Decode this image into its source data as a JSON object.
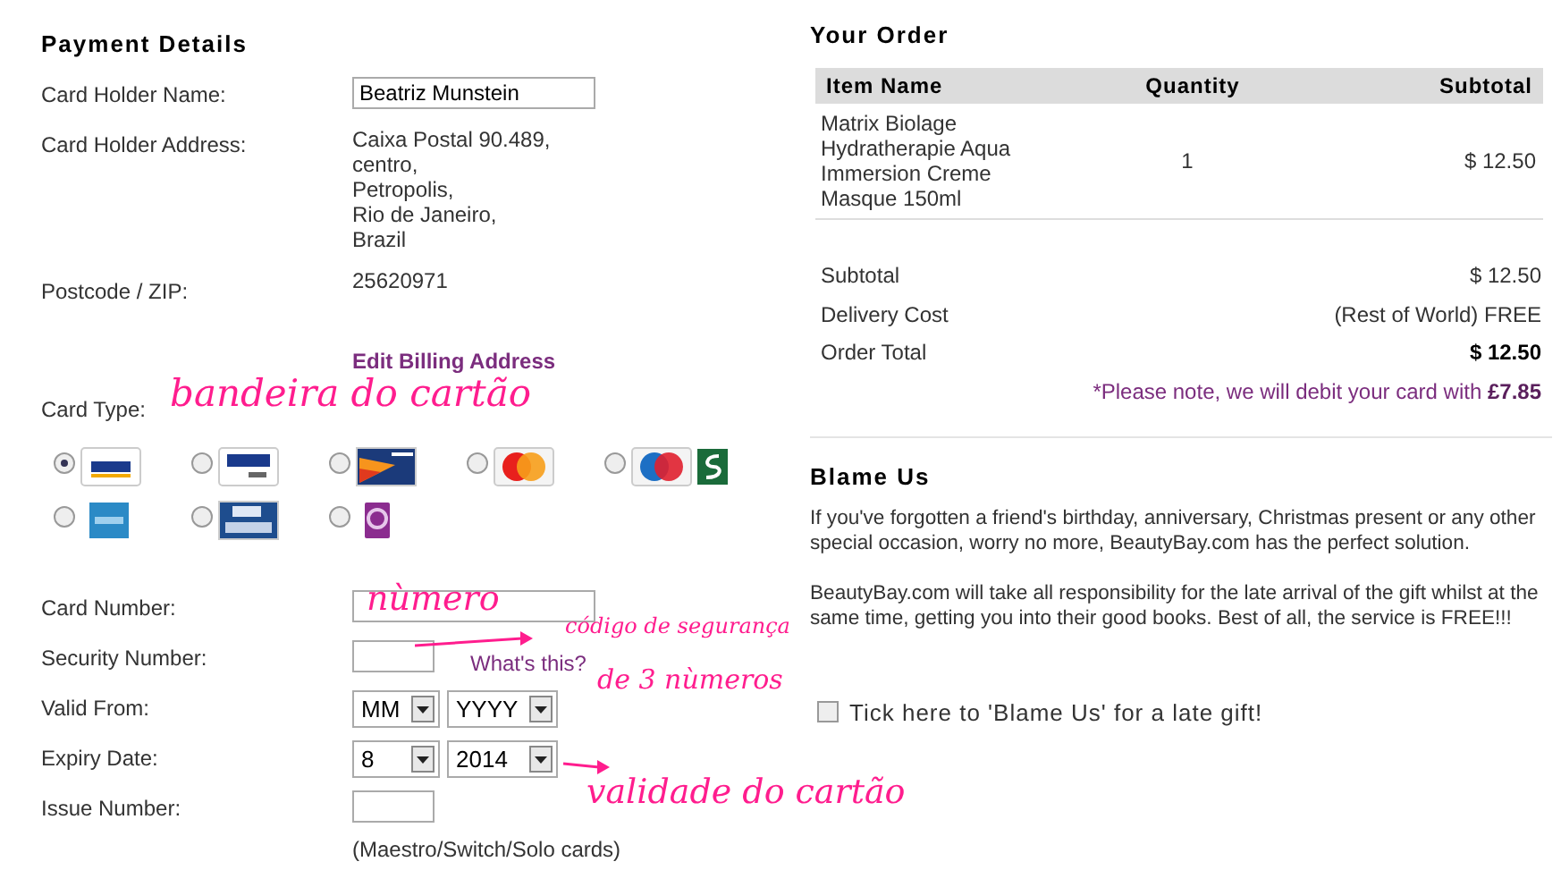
{
  "payment": {
    "title": "Payment Details",
    "holder_name": {
      "label": "Card Holder Name:",
      "value": "Beatriz Munstein"
    },
    "address": {
      "label": "Card Holder Address:",
      "lines": [
        "Caixa Postal 90.489,",
        "centro,",
        "Petropolis,",
        "Rio de Janeiro,",
        "Brazil"
      ]
    },
    "postcode": {
      "label": "Postcode / ZIP:",
      "value": "25620971"
    },
    "edit_link": "Edit Billing Address",
    "card_type": {
      "label": "Card Type:",
      "options": [
        {
          "kind": "visa",
          "selected": true
        },
        {
          "kind": "visa-debit",
          "selected": false
        },
        {
          "kind": "delta",
          "selected": false
        },
        {
          "kind": "mastercard",
          "selected": false
        },
        {
          "kind": "maestro-switch",
          "selected": false
        },
        {
          "kind": "amex",
          "selected": false
        },
        {
          "kind": "visa-electron",
          "selected": false
        },
        {
          "kind": "solo",
          "selected": false
        }
      ]
    },
    "card_number": {
      "label": "Card Number:"
    },
    "security": {
      "label": "Security Number:",
      "help_link": "What's this?"
    },
    "valid_from": {
      "label": "Valid From:",
      "month": "MM",
      "year": "YYYY"
    },
    "expiry": {
      "label": "Expiry Date:",
      "month": "8",
      "year": "2014"
    },
    "issue": {
      "label": "Issue Number:",
      "note": "(Maestro/Switch/Solo cards)"
    }
  },
  "order": {
    "title": "Your Order",
    "columns": [
      "Item Name",
      "Quantity",
      "Subtotal"
    ],
    "rows": [
      {
        "item": "Matrix  Biolage Hydratherapie Aqua Immersion Creme Masque 150ml",
        "quantity": "1",
        "subtotal": "$ 12.50"
      }
    ],
    "summary": [
      {
        "label": "Subtotal",
        "value": "$ 12.50",
        "bold": false
      },
      {
        "label": "Delivery Cost",
        "value": "(Rest of World)  FREE",
        "bold": false
      },
      {
        "label": "Order Total",
        "value": "$ 12.50",
        "bold": true
      }
    ],
    "note": "*Please note, we will debit your card with **£7.85**"
  },
  "blame": {
    "title": "Blame Us",
    "paragraphs": [
      "If you've forgotten a friend's birthday, anniversary, Christmas present or any other special occasion, worry no more, BeautyBay.com has the perfect solution.",
      "BeautyBay.com will take all responsibility for the late arrival of the gift whilst at the same time, getting you into their good books. Best of all, the service is FREE!!!"
    ],
    "checkbox": {
      "label": "Tick here to 'Blame Us' for a late gift!",
      "checked": false
    }
  },
  "annotations": [
    {
      "kind": "text",
      "text": "bandeira do cartão"
    },
    {
      "kind": "text",
      "text": "nùmero"
    },
    {
      "kind": "arrow"
    },
    {
      "kind": "text",
      "text": "código de segurança"
    },
    {
      "kind": "text",
      "text": "de 3 nùmeros"
    },
    {
      "kind": "arrow"
    },
    {
      "kind": "text",
      "text": "validade do cartão"
    }
  ]
}
